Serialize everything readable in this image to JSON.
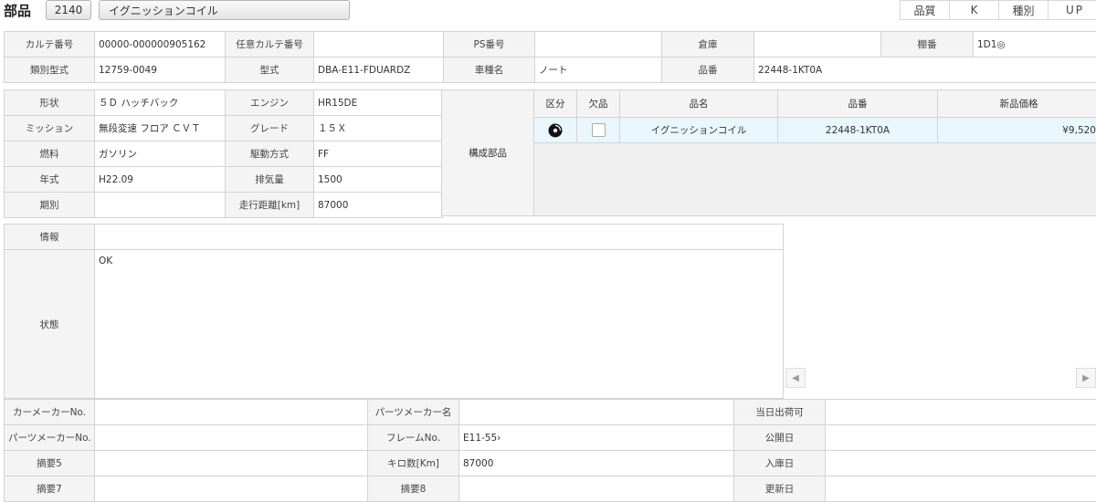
{
  "header": {
    "title": "部品",
    "code": "2140",
    "part_name": "イグニッションコイル",
    "quality_label": "品質",
    "quality_value": "K",
    "type_label": "種別",
    "type_value": "UP"
  },
  "info1": {
    "karte_no_label": "カルテ番号",
    "karte_no": "00000-000000905162",
    "opt_karte_label": "任意カルテ番号",
    "opt_karte": "",
    "ps_label": "PS番号",
    "ps": "",
    "warehouse_label": "倉庫",
    "warehouse": "",
    "shelf_label": "棚番",
    "shelf": "1D1◎",
    "class_model_label": "類別型式",
    "class_model": "12759-0049",
    "model_label": "型式",
    "model": "DBA-E11-FDUARDZ",
    "car_name_label": "車種名",
    "car_name": "ノート",
    "part_no_label": "品番",
    "part_no": "22448-1KT0A"
  },
  "spec": {
    "shape_label": "形状",
    "shape": "５Ｄ ハッチバック",
    "engine_label": "エンジン",
    "engine": "HR15DE",
    "mission_label": "ミッション",
    "mission": "無段変速 フロア ＣＶＴ",
    "grade_label": "グレード",
    "grade": "１５Ｘ",
    "fuel_label": "燃料",
    "fuel": "ガソリン",
    "drive_label": "駆動方式",
    "drive": "FF",
    "year_label": "年式",
    "year": "H22.09",
    "displacement_label": "排気量",
    "displacement": "1500",
    "period_label": "期別",
    "period": "",
    "mileage_label": "走行距離[km]",
    "mileage": "87000",
    "components_label": "構成部品"
  },
  "parts_table": {
    "headers": [
      "区分",
      "欠品",
      "品名",
      "品番",
      "新品価格"
    ],
    "rows": [
      {
        "category_icon": "disc-icon",
        "missing": false,
        "name": "イグニッションコイル",
        "number": "22448-1KT0A",
        "price": "¥9,520"
      }
    ]
  },
  "memo": {
    "info_label": "情報",
    "info": "",
    "status_label": "状態",
    "status": "OK"
  },
  "bottom": {
    "car_maker_no_label": "カーメーカーNo.",
    "car_maker_no": "",
    "parts_maker_name_label": "パーツメーカー名",
    "parts_maker_name": "",
    "same_day_label": "当日出荷可",
    "same_day": "",
    "parts_maker_no_label": "パーツメーカーNo.",
    "parts_maker_no": "",
    "frame_label": "フレームNo.",
    "frame": "E11-55›",
    "public_date_label": "公開日",
    "public_date": "",
    "summary5_label": "摘要5",
    "summary5": "",
    "km_label": "キロ数[Km]",
    "km": "87000",
    "stock_date_label": "入庫日",
    "stock_date": "",
    "summary7_label": "摘要7",
    "summary7": "",
    "summary8_label": "摘要8",
    "summary8": "",
    "update_date_label": "更新日",
    "update_date": ""
  },
  "scroll": {
    "left_icon": "chevron-left-icon",
    "right_icon": "chevron-right-icon"
  }
}
